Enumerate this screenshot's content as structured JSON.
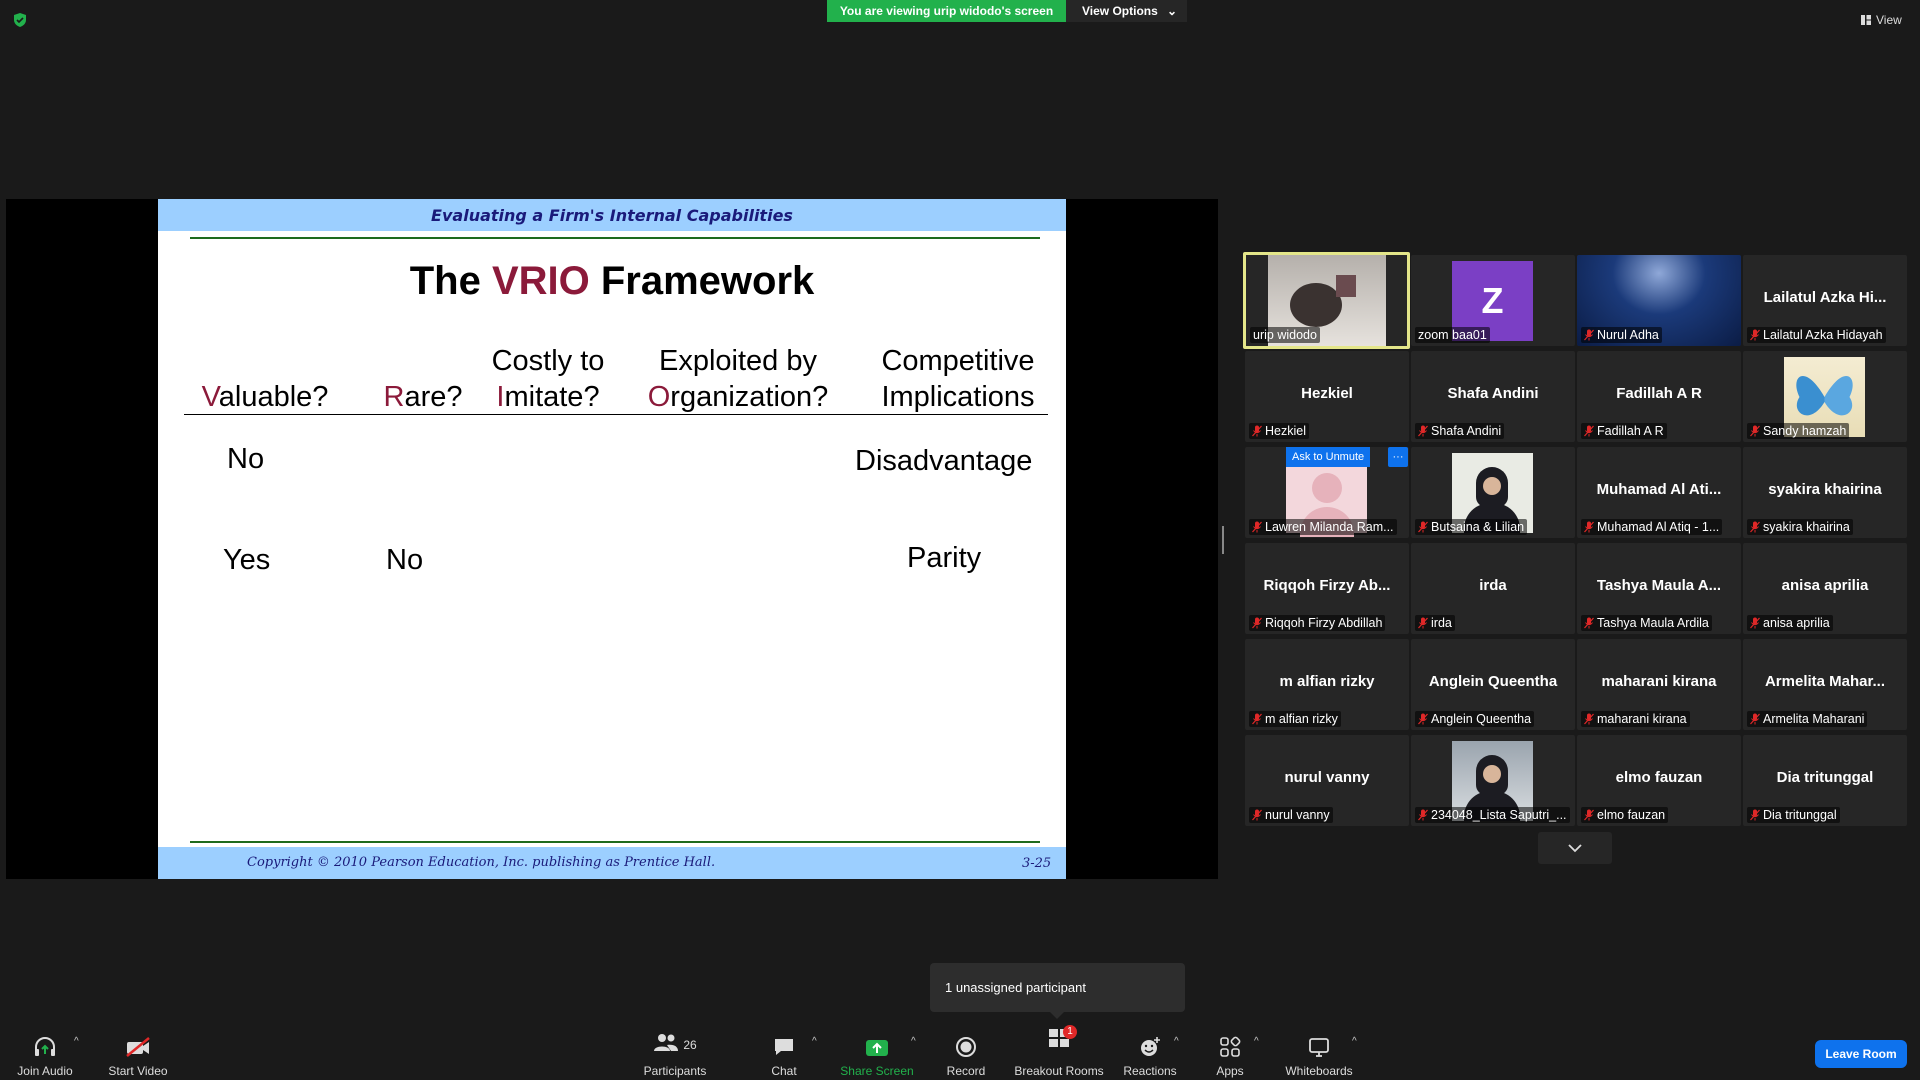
{
  "top": {
    "viewing_banner": "You are viewing urip widodo's screen",
    "view_options": "View Options",
    "view_label": "View"
  },
  "slide": {
    "header": "Evaluating a Firm's Internal Capabilities",
    "title_pre": "The ",
    "title_accent": "VRIO",
    "title_post": " Framework",
    "columns": [
      {
        "accent": "V",
        "rest": "aluable?"
      },
      {
        "accent": "R",
        "rest": "are?"
      },
      {
        "line1": "Costly to",
        "accent": "I",
        "rest": "mitate?"
      },
      {
        "line1": "Exploited by",
        "accent": "O",
        "rest": "rganization?"
      },
      {
        "line1": "Competitive",
        "line2": "Implications"
      }
    ],
    "rows": [
      {
        "valuable": "No",
        "implication": "Disadvantage"
      },
      {
        "valuable": "Yes",
        "rare": "No",
        "implication": "Parity"
      }
    ],
    "footer": "Copyright © 2010 Pearson Education, Inc. publishing as Prentice Hall.",
    "page": "3-25"
  },
  "participants_tiles": [
    {
      "label": "urip widodo",
      "kind": "video",
      "muted": false
    },
    {
      "label": "zoom baa01",
      "kind": "letter",
      "letter": "Z",
      "muted": false
    },
    {
      "label": "Nurul Adha",
      "kind": "image-lamp",
      "muted": true
    },
    {
      "big": "Lailatul  Azka  Hi...",
      "label": "Lailatul Azka Hidayah",
      "muted": true
    },
    {
      "big": "Hezkiel",
      "label": "Hezkiel",
      "muted": true
    },
    {
      "big": "Shafa Andini",
      "label": "Shafa Andini",
      "muted": true
    },
    {
      "big": "Fadillah A R",
      "label": "Fadillah A R",
      "muted": true
    },
    {
      "label": "Sandy hamzah",
      "kind": "image-butterfly",
      "muted": true
    },
    {
      "label": "Lawren Milanda Ram...",
      "kind": "image-pink",
      "muted": true,
      "ask_unmute": "Ask to Unmute",
      "more": "···"
    },
    {
      "label": "Butsaina & Lilian",
      "kind": "image-hijab",
      "muted": true
    },
    {
      "big": "Muhamad Al Ati...",
      "label": "Muhamad Al Atiq - 1...",
      "muted": true
    },
    {
      "big": "syakira khairina",
      "label": "syakira khairina",
      "muted": true
    },
    {
      "big": "Riqqoh  Firzy  Ab...",
      "label": "Riqqoh Firzy Abdillah",
      "muted": true
    },
    {
      "big": "irda",
      "label": "irda",
      "muted": true
    },
    {
      "big": "Tashya Maula A...",
      "label": "Tashya Maula Ardila",
      "muted": true
    },
    {
      "big": "anisa aprilia",
      "label": "anisa aprilia",
      "muted": true
    },
    {
      "big": "m alfian rizky",
      "label": "m alfian rizky",
      "muted": true
    },
    {
      "big": "Anglein Queentha",
      "label": "Anglein Queentha",
      "muted": true
    },
    {
      "big": "maharani kirana",
      "label": "maharani kirana",
      "muted": true
    },
    {
      "big": "Armelita  Mahar...",
      "label": "Armelita Maharani",
      "muted": true
    },
    {
      "big": "nurul vanny",
      "label": "nurul vanny",
      "muted": true
    },
    {
      "label": "234048_Lista Saputri_...",
      "kind": "image-hijab2",
      "muted": true
    },
    {
      "big": "elmo fauzan",
      "label": "elmo fauzan",
      "muted": true
    },
    {
      "big": "Dia tritunggal",
      "label": "Dia tritunggal",
      "muted": true
    }
  ],
  "toast": "1 unassigned participant",
  "toolbar": {
    "join_audio": "Join Audio",
    "start_video": "Start Video",
    "participants": "Participants",
    "participants_count": "26",
    "chat": "Chat",
    "share_screen": "Share Screen",
    "record": "Record",
    "breakout_rooms": "Breakout Rooms",
    "breakout_badge": "1",
    "reactions": "Reactions",
    "apps": "Apps",
    "whiteboards": "Whiteboards",
    "leave": "Leave Room"
  },
  "colors": {
    "green": "#22b14c",
    "accent": "#8b1a3a",
    "blue": "#0e72ed",
    "slide_band": "#9ccfff"
  }
}
